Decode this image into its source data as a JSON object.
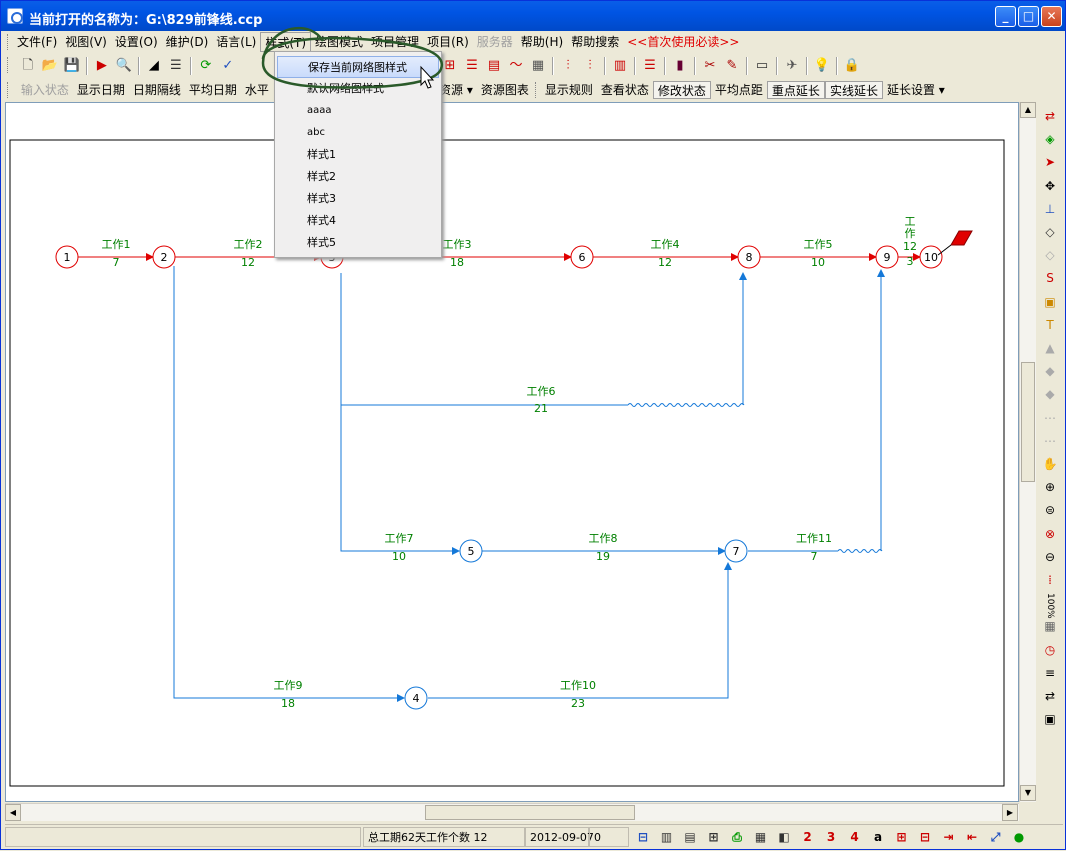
{
  "window": {
    "title": "当前打开的名称为：G:\\829前锋线.ccp",
    "minimize": "_",
    "maximize": "□",
    "close": "✕"
  },
  "menu": [
    {
      "label": "文件(F)",
      "state": "normal"
    },
    {
      "label": "视图(V)",
      "state": "normal"
    },
    {
      "label": "设置(O)",
      "state": "normal"
    },
    {
      "label": "维护(D)",
      "state": "normal"
    },
    {
      "label": "语言(L)",
      "state": "normal"
    },
    {
      "label": "样式(T)",
      "state": "active"
    },
    {
      "label": "绘图模式",
      "state": "normal"
    },
    {
      "label": "项目管理",
      "state": "normal"
    },
    {
      "label": "项目(R)",
      "state": "normal"
    },
    {
      "label": "服务器",
      "state": "disabled"
    },
    {
      "label": "帮助(H)",
      "state": "normal"
    },
    {
      "label": "帮助搜索",
      "state": "normal"
    },
    {
      "label": "<<首次使用必读>>",
      "state": "red"
    }
  ],
  "toolbar1": [
    {
      "name": "new-icon",
      "glyph": "🗋",
      "color": "#333"
    },
    {
      "name": "open-icon",
      "glyph": "📂",
      "color": "#c89000"
    },
    {
      "name": "save-icon",
      "glyph": "💾",
      "color": "#888"
    },
    {
      "sep": true
    },
    {
      "name": "export-icon",
      "glyph": "▶",
      "color": "#c00"
    },
    {
      "name": "print-preview-icon",
      "glyph": "🔍",
      "color": "#333"
    },
    {
      "sep": true
    },
    {
      "name": "triangle-icon",
      "glyph": "◢",
      "color": "#000"
    },
    {
      "name": "indent-icon",
      "glyph": "☰",
      "color": "#333"
    },
    {
      "sep": true
    },
    {
      "name": "refresh-icon",
      "glyph": "⟳",
      "color": "#090"
    },
    {
      "name": "check-icon",
      "glyph": "✓",
      "color": "#2050c0"
    }
  ],
  "toolbar1_right": [
    {
      "name": "grid-icon",
      "glyph": "⊞",
      "color": "#c00"
    },
    {
      "name": "align-icon",
      "glyph": "☰",
      "color": "#c00"
    },
    {
      "name": "box-icon",
      "glyph": "▤",
      "color": "#c00"
    },
    {
      "name": "curve-icon",
      "glyph": "〜",
      "color": "#c00"
    },
    {
      "name": "building-icon",
      "glyph": "▦",
      "color": "#555"
    },
    {
      "sep": true
    },
    {
      "name": "split-icon",
      "glyph": "⫶",
      "color": "#c00"
    },
    {
      "name": "split2-icon",
      "glyph": "⫶",
      "color": "#c00"
    },
    {
      "sep": true
    },
    {
      "name": "chart-icon",
      "glyph": "▥",
      "color": "#c00"
    },
    {
      "sep": true
    },
    {
      "name": "gantt-icon",
      "glyph": "☰",
      "color": "#c00"
    },
    {
      "sep": true
    },
    {
      "name": "books-icon",
      "glyph": "▮",
      "color": "#603"
    },
    {
      "sep": true
    },
    {
      "name": "tools-icon",
      "glyph": "✂",
      "color": "#a00"
    },
    {
      "name": "pen-icon",
      "glyph": "✎",
      "color": "#a00"
    },
    {
      "sep": true
    },
    {
      "name": "film-icon",
      "glyph": "▭",
      "color": "#333"
    },
    {
      "sep": true
    },
    {
      "name": "plane-icon",
      "glyph": "✈",
      "color": "#555"
    },
    {
      "sep": true
    },
    {
      "name": "bulb-icon",
      "glyph": "💡",
      "color": "#c90"
    },
    {
      "sep": true
    },
    {
      "name": "lock-icon",
      "glyph": "🔒",
      "color": "#c80"
    }
  ],
  "toolbar2": [
    {
      "label": "输入状态",
      "state": "disabled"
    },
    {
      "label": "显示日期",
      "state": "normal"
    },
    {
      "label": "日期隔线",
      "state": "normal"
    },
    {
      "label": "平均日期",
      "state": "normal"
    },
    {
      "label": "水平",
      "state": "normal"
    }
  ],
  "toolbar2_right": [
    {
      "label": "床资源",
      "state": "normal",
      "arrow": true
    },
    {
      "label": "资源图表",
      "state": "normal"
    },
    {
      "grip": true
    },
    {
      "label": "显示规则",
      "state": "normal"
    },
    {
      "label": "查看状态",
      "state": "normal"
    },
    {
      "label": "修改状态",
      "state": "boxed"
    },
    {
      "label": "平均点距",
      "state": "normal"
    },
    {
      "label": "重点延长",
      "state": "boxed"
    },
    {
      "label": "实线延长",
      "state": "boxed"
    },
    {
      "label": "延长设置",
      "state": "normal",
      "arrow": true
    }
  ],
  "dropdown": [
    {
      "label": "保存当前网络图样式",
      "highlighted": true
    },
    {
      "label": "默认网络图样式"
    },
    {
      "label": "aaaa",
      "small": true
    },
    {
      "label": "abc",
      "small": true
    },
    {
      "label": "样式1"
    },
    {
      "label": "样式2"
    },
    {
      "label": "样式3"
    },
    {
      "label": "样式4"
    },
    {
      "label": "样式5"
    }
  ],
  "colors": {
    "critical": "#e00000",
    "normal": "#1478d8",
    "label": "#008000"
  },
  "diagram": {
    "nodes": [
      {
        "id": "1",
        "critical": true
      },
      {
        "id": "2",
        "critical": true
      },
      {
        "id": "3",
        "critical": true
      },
      {
        "id": "4",
        "critical": false
      },
      {
        "id": "5",
        "critical": false
      },
      {
        "id": "6",
        "critical": true
      },
      {
        "id": "7",
        "critical": false
      },
      {
        "id": "8",
        "critical": true
      },
      {
        "id": "9",
        "critical": true
      },
      {
        "id": "10",
        "critical": true
      }
    ],
    "activities": [
      {
        "name": "工作1",
        "duration": "7",
        "critical": true
      },
      {
        "name": "工作2",
        "duration": "12",
        "critical": true
      },
      {
        "name": "工作3",
        "duration": "18",
        "critical": true
      },
      {
        "name": "工作4",
        "duration": "12",
        "critical": true
      },
      {
        "name": "工作5",
        "duration": "10",
        "critical": true
      },
      {
        "name": "工作",
        "duration": "12",
        "critical": true,
        "vertical": true,
        "extra": "3"
      },
      {
        "name": "工作6",
        "duration": "21",
        "critical": false
      },
      {
        "name": "工作7",
        "duration": "10",
        "critical": false
      },
      {
        "name": "工作8",
        "duration": "19",
        "critical": false
      },
      {
        "name": "工作11",
        "duration": "7",
        "critical": false
      },
      {
        "name": "工作9",
        "duration": "18",
        "critical": false
      },
      {
        "name": "工作10",
        "duration": "23",
        "critical": false
      }
    ]
  },
  "right_toolbar": [
    {
      "name": "link-icon",
      "glyph": "⇄",
      "color": "#c00"
    },
    {
      "name": "palette-icon",
      "glyph": "◈",
      "color": "#090"
    },
    {
      "name": "select-arrow-icon",
      "glyph": "➤",
      "color": "#c00"
    },
    {
      "name": "move-icon",
      "glyph": "✥",
      "color": "#000"
    },
    {
      "name": "node-icon",
      "glyph": "⊥",
      "color": "#2050c0"
    },
    {
      "name": "eraser-icon",
      "glyph": "◇",
      "color": "#333"
    },
    {
      "name": "eraser2-icon",
      "glyph": "◇",
      "color": "#aaa"
    },
    {
      "name": "set-icon",
      "glyph": "S",
      "color": "#c00"
    },
    {
      "name": "hi-icon",
      "glyph": "▣",
      "color": "#c80"
    },
    {
      "name": "text-icon",
      "glyph": "T",
      "color": "#c80"
    },
    {
      "name": "layer-up-icon",
      "glyph": "▲",
      "color": "#aaa"
    },
    {
      "name": "layer-icon",
      "glyph": "◆",
      "color": "#aaa"
    },
    {
      "name": "layer-down-icon",
      "glyph": "◆",
      "color": "#aaa"
    },
    {
      "name": "dash-icon",
      "glyph": "⋯",
      "color": "#aaa"
    },
    {
      "name": "dash2-icon",
      "glyph": "⋯",
      "color": "#aaa"
    },
    {
      "name": "hand-icon",
      "glyph": "✋",
      "color": "#000"
    },
    {
      "name": "zoom-in-icon",
      "glyph": "⊕",
      "color": "#000"
    },
    {
      "name": "zoom-fit-icon",
      "glyph": "⊜",
      "color": "#000"
    },
    {
      "name": "target-icon",
      "glyph": "⊗",
      "color": "#c00"
    },
    {
      "name": "zoom-out-icon",
      "glyph": "⊖",
      "color": "#000"
    },
    {
      "name": "bracket-icon",
      "glyph": "⁞",
      "color": "#c00"
    },
    {
      "name": "zoom-100-icon",
      "glyph": "100%",
      "color": "#000"
    },
    {
      "name": "calendar-icon",
      "glyph": "▦",
      "color": "#666"
    },
    {
      "name": "clock-icon",
      "glyph": "◷",
      "color": "#c00"
    },
    {
      "name": "list-icon",
      "glyph": "≡",
      "color": "#000"
    },
    {
      "name": "swap-icon",
      "glyph": "⇄",
      "color": "#000"
    },
    {
      "name": "frame-icon",
      "glyph": "▣",
      "color": "#000"
    }
  ],
  "status": {
    "summary": "总工期62天工作个数 12",
    "date": "2012-09-07",
    "count": "0"
  },
  "status_buttons": [
    {
      "name": "view-network-icon",
      "glyph": "⊟",
      "color": "#2050c0"
    },
    {
      "name": "view-gantt-icon",
      "glyph": "▥",
      "color": "#333"
    },
    {
      "name": "view-table-icon",
      "glyph": "▤",
      "color": "#333"
    },
    {
      "name": "view-tree-icon",
      "glyph": "⊞",
      "color": "#333"
    },
    {
      "name": "printer-icon",
      "glyph": "⎙",
      "color": "#090"
    },
    {
      "name": "calendar2-icon",
      "glyph": "▦",
      "color": "#333"
    },
    {
      "name": "panel-icon",
      "glyph": "◧",
      "color": "#333"
    },
    {
      "name": "mode-2-icon",
      "glyph": "2",
      "color": "#c00"
    },
    {
      "name": "mode-3-icon",
      "glyph": "3",
      "color": "#c00"
    },
    {
      "name": "mode-4-icon",
      "glyph": "4",
      "color": "#c00"
    },
    {
      "name": "mode-a-icon",
      "glyph": "a",
      "color": "#000"
    },
    {
      "name": "align-h-icon",
      "glyph": "⊞",
      "color": "#c00"
    },
    {
      "name": "align-v-icon",
      "glyph": "⊟",
      "color": "#c00"
    },
    {
      "name": "move-right-icon",
      "glyph": "⇥",
      "color": "#c00"
    },
    {
      "name": "move-left-icon",
      "glyph": "⇤",
      "color": "#c00"
    },
    {
      "name": "fit-icon",
      "glyph": "⤢",
      "color": "#2050c0"
    },
    {
      "name": "globe-icon",
      "glyph": "●",
      "color": "#090"
    }
  ]
}
